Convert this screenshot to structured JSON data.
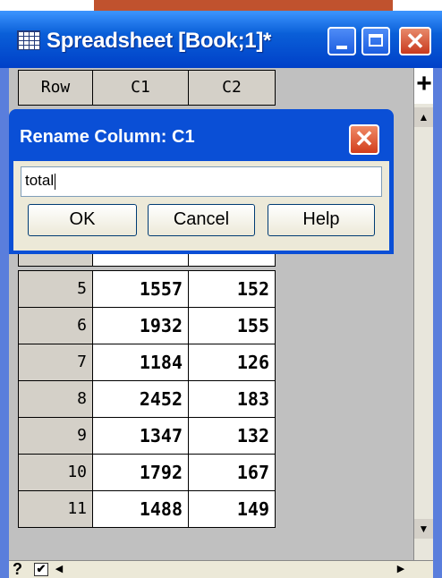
{
  "window": {
    "title": "Spreadsheet [Book;1]*"
  },
  "grid": {
    "columns": [
      "Row",
      "C1",
      "C2"
    ],
    "rows": [
      {
        "row": "5",
        "c1": "1557",
        "c2": "152"
      },
      {
        "row": "6",
        "c1": "1932",
        "c2": "155"
      },
      {
        "row": "7",
        "c1": "1184",
        "c2": "126"
      },
      {
        "row": "8",
        "c1": "2452",
        "c2": "183"
      },
      {
        "row": "9",
        "c1": "1347",
        "c2": "132"
      },
      {
        "row": "10",
        "c1": "1792",
        "c2": "167"
      },
      {
        "row": "11",
        "c1": "1488",
        "c2": "149"
      }
    ],
    "add_column_label": "+"
  },
  "dialog": {
    "title": "Rename Column: C1",
    "input_value": "total",
    "ok_label": "OK",
    "cancel_label": "Cancel",
    "help_label": "Help"
  },
  "statusbar": {
    "help_label": "?",
    "checkbox_checked": true
  }
}
